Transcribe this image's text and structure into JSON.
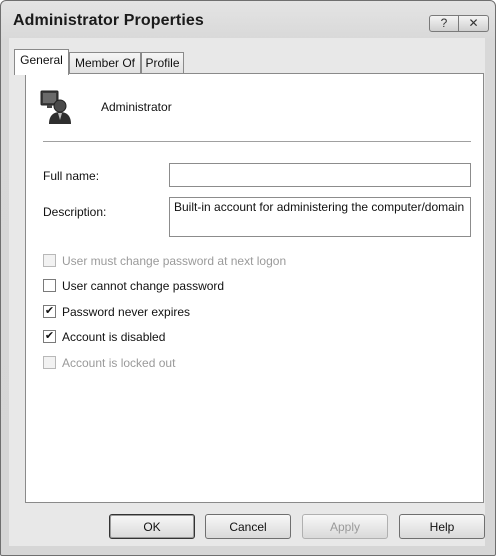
{
  "window": {
    "title": "Administrator Properties",
    "help_glyph": "?",
    "close_glyph": "✕"
  },
  "tabs": [
    {
      "label": "General",
      "active": true
    },
    {
      "label": "Member Of",
      "active": false
    },
    {
      "label": "Profile",
      "active": false
    }
  ],
  "general": {
    "username": "Administrator",
    "full_name_label": "Full name:",
    "full_name_value": "",
    "description_label": "Description:",
    "description_value": "Built-in account for administering the computer/domain",
    "checkboxes": [
      {
        "label": "User must change password at next logon",
        "checked": false,
        "enabled": false
      },
      {
        "label": "User cannot change password",
        "checked": false,
        "enabled": true
      },
      {
        "label": "Password never expires",
        "checked": true,
        "enabled": true
      },
      {
        "label": "Account is disabled",
        "checked": true,
        "enabled": true
      },
      {
        "label": "Account is locked out",
        "checked": false,
        "enabled": false
      }
    ]
  },
  "buttons": {
    "ok": "OK",
    "cancel": "Cancel",
    "apply": "Apply",
    "help": "Help"
  },
  "check_glyph": "✔"
}
